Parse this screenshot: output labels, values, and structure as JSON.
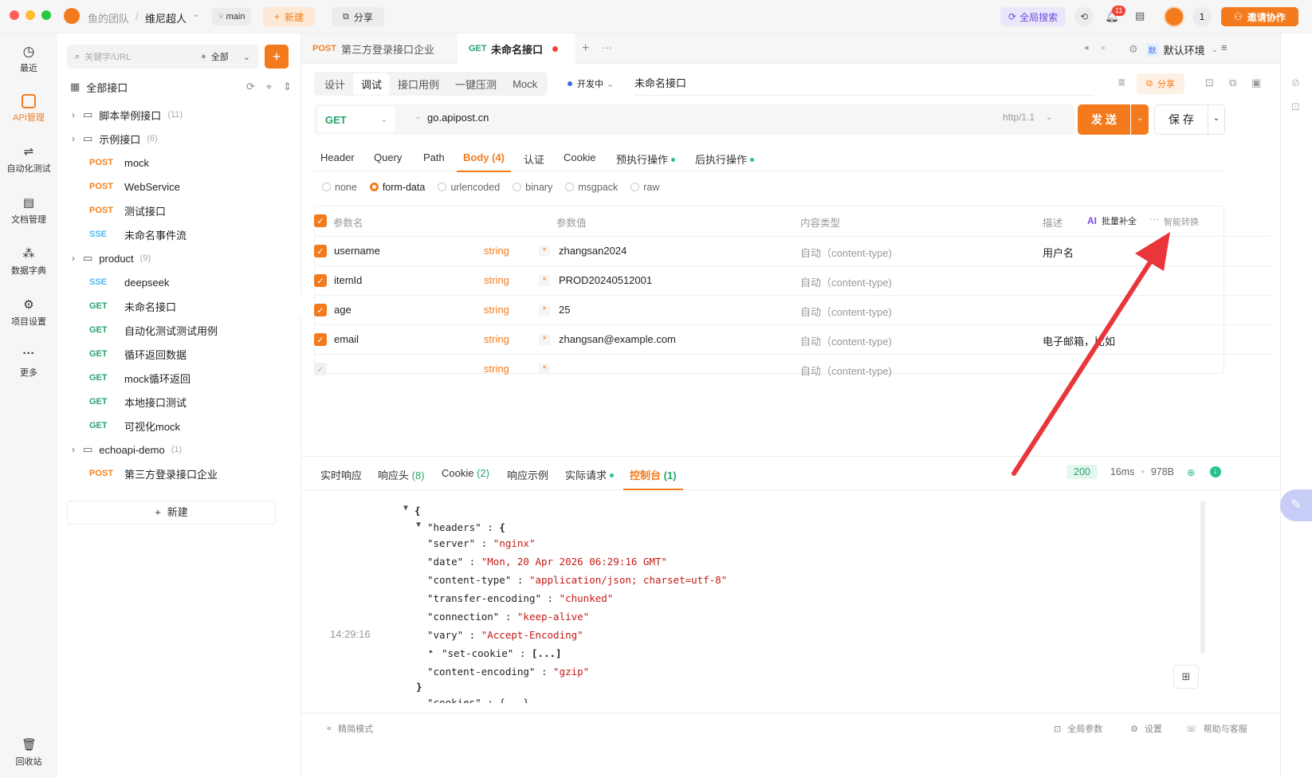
{
  "titlebar": {
    "team": "鱼的团队",
    "separator": "/",
    "project": "维尼超人",
    "branch": "main",
    "new_btn": "新建",
    "share_btn": "分享",
    "global_search": "全局搜索",
    "notif_count": "11",
    "user_count": "1",
    "invite_btn": "邀请协作"
  },
  "rail": [
    {
      "label": "最近",
      "icon": "clock-icon"
    },
    {
      "label": "API管理",
      "icon": "api-icon"
    },
    {
      "label": "自动化测试",
      "icon": "automation-icon"
    },
    {
      "label": "文档管理",
      "icon": "document-icon"
    },
    {
      "label": "数据字典",
      "icon": "dictionary-icon"
    },
    {
      "label": "项目设置",
      "icon": "settings-icon"
    },
    {
      "label": "更多",
      "icon": "more-icon"
    },
    {
      "label": "回收站",
      "icon": "trash-icon"
    }
  ],
  "tree": {
    "search_placeholder": "关键字/URL",
    "filter_label": "全部",
    "all_label": "全部接口",
    "new_label": "新建",
    "items": [
      {
        "type": "folder",
        "name": "脚本举例接口",
        "count": "(11)"
      },
      {
        "type": "folder",
        "name": "示例接口",
        "count": "(6)"
      },
      {
        "type": "api",
        "method": "POST",
        "name": "mock"
      },
      {
        "type": "api",
        "method": "POST",
        "name": "WebService"
      },
      {
        "type": "api",
        "method": "POST",
        "name": "测试接口"
      },
      {
        "type": "api",
        "method": "SSE",
        "name": "未命名事件流"
      },
      {
        "type": "folder",
        "name": "product",
        "count": "(9)"
      },
      {
        "type": "api",
        "method": "SSE",
        "name": "deepseek"
      },
      {
        "type": "api",
        "method": "GET",
        "name": "未命名接口"
      },
      {
        "type": "api",
        "method": "GET",
        "name": "自动化测试测试用例"
      },
      {
        "type": "api",
        "method": "GET",
        "name": "循环返回数据"
      },
      {
        "type": "api",
        "method": "GET",
        "name": "mock循环返回"
      },
      {
        "type": "api",
        "method": "GET",
        "name": "本地接口测试"
      },
      {
        "type": "api",
        "method": "GET",
        "name": "可视化mock"
      },
      {
        "type": "folder",
        "name": "echoapi-demo",
        "count": "(1)"
      },
      {
        "type": "api",
        "method": "POST",
        "name": "第三方登录接口企业"
      }
    ]
  },
  "doc_tabs": [
    {
      "method": "POST",
      "name": "第三方登录接口企业"
    },
    {
      "method": "GET",
      "name": "未命名接口"
    }
  ],
  "env_label": "默认环境",
  "env_badge": "默",
  "mode_tabs": [
    "设计",
    "调试",
    "接口用例",
    "一键压测",
    "Mock"
  ],
  "status_label": "开发中",
  "api_name": "未命名接口",
  "share_label": "分享",
  "request": {
    "method": "GET",
    "url": "go.apipost.cn",
    "protocol": "http/1.1",
    "send": "发 送",
    "save": "保 存"
  },
  "param_tabs": [
    "Header",
    "Query",
    "Path",
    "Body (4)",
    "认证",
    "Cookie",
    "预执行操作",
    "后执行操作"
  ],
  "body_types": [
    "none",
    "form-data",
    "urlencoded",
    "binary",
    "msgpack",
    "raw"
  ],
  "table": {
    "headers": {
      "name": "参数名",
      "value": "参数值",
      "content_type": "内容类型",
      "desc": "描述",
      "ai": "批量补全",
      "smart": "智能转换"
    },
    "rows": [
      {
        "name": "username",
        "type": "string",
        "value": "zhangsan2024",
        "ct": "自动（content-type)",
        "desc": "用户名"
      },
      {
        "name": "itemId",
        "type": "string",
        "value": "PROD20240512001",
        "ct": "自动（content-type)",
        "desc": ""
      },
      {
        "name": "age",
        "type": "string",
        "value": "25",
        "ct": "自动（content-type)",
        "desc": ""
      },
      {
        "name": "email",
        "type": "string",
        "value": "zhangsan@example.com",
        "ct": "自动（content-type)",
        "desc": "电子邮箱，比如"
      },
      {
        "name": "",
        "type": "string",
        "value": "",
        "ct": "自动（content-type)",
        "desc": ""
      }
    ]
  },
  "response_tabs": [
    {
      "label": "实时响应",
      "count": ""
    },
    {
      "label": "响应头",
      "count": "(8)"
    },
    {
      "label": "Cookie",
      "count": "(2)"
    },
    {
      "label": "响应示例",
      "count": ""
    },
    {
      "label": "实际请求",
      "count": ""
    },
    {
      "label": "控制台",
      "count": "(1)"
    }
  ],
  "response_meta": {
    "status": "200",
    "time": "16ms",
    "size": "978B"
  },
  "console": {
    "time": "14:29:16",
    "headers_key": "\"headers\"",
    "entries": [
      {
        "k": "\"server\"",
        "v": "\"nginx\""
      },
      {
        "k": "\"date\"",
        "v": "\"Mon, 20 Apr 2026 06:29:16 GMT\""
      },
      {
        "k": "\"content-type\"",
        "v": "\"application/json; charset=utf-8\""
      },
      {
        "k": "\"transfer-encoding\"",
        "v": "\"chunked\""
      },
      {
        "k": "\"connection\"",
        "v": "\"keep-alive\""
      },
      {
        "k": "\"vary\"",
        "v": "\"Accept-Encoding\""
      },
      {
        "k": "\"set-cookie\"",
        "v": "[...]"
      },
      {
        "k": "\"content-encoding\"",
        "v": "\"gzip\""
      }
    ],
    "next_key": "\"cookies\""
  },
  "footer": {
    "compact": "精简模式",
    "global_params": "全局参数",
    "settings": "设置",
    "help": "帮助与客服"
  },
  "colors": {
    "accent": "#f37b1d",
    "get": "#27a36a",
    "post": "#f0821e",
    "sse": "#4db6f5",
    "arrow": "#e8363a"
  }
}
